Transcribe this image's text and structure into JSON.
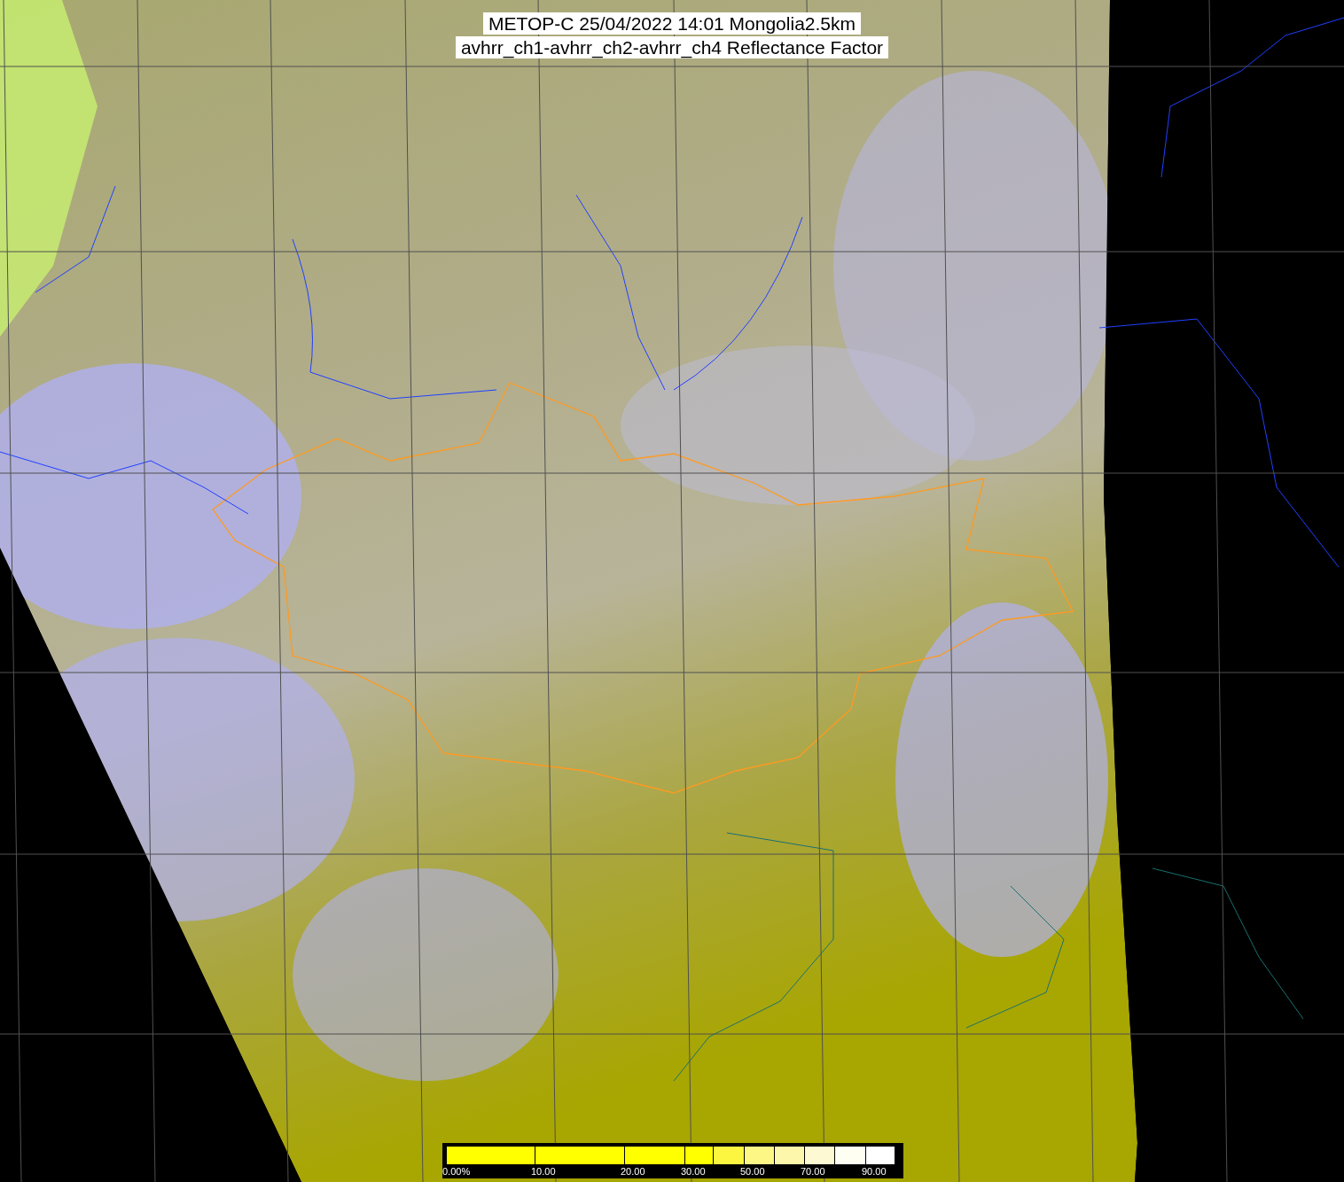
{
  "title": {
    "lines": [
      "METOP-C 25/04/2022 14:01 Mongolia2.5km",
      "avhrr_ch1-avhrr_ch2-avhrr_ch4 Reflectance Factor"
    ]
  },
  "colorbar": {
    "segments": [
      {
        "color": "#ffff00",
        "label": "0.00%"
      },
      {
        "color": "#ffff00",
        "label": "10.00"
      },
      {
        "color": "#ffff00",
        "label": "20.00"
      },
      {
        "color": "#ffff00",
        "label": "30.00"
      },
      {
        "color": "#fdf640"
      },
      {
        "color": "#fdf786",
        "label": "50.00"
      },
      {
        "color": "#fcf7aa"
      },
      {
        "color": "#fdf9d2",
        "label": "70.00"
      },
      {
        "color": "#fefef2"
      },
      {
        "color": "#ffffff",
        "label": "90.00"
      }
    ]
  }
}
